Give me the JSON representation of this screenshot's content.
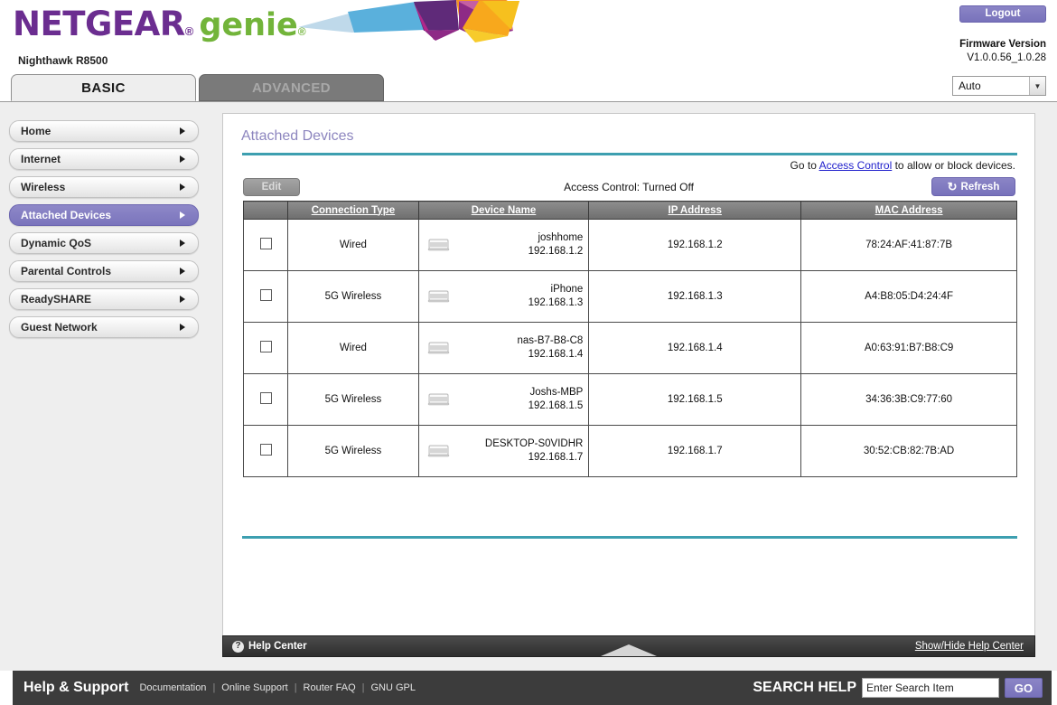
{
  "brand": {
    "name": "NETGEAR",
    "registered_mark": "®",
    "product": "genie",
    "product_mark": "®",
    "model": "Nighthawk R8500",
    "colors": {
      "netgear_purple": "#6b2d90",
      "genie_green": "#72b43a",
      "accent_purple": "#7872bb",
      "teal_rule": "#3d9fb0"
    }
  },
  "header": {
    "logout_label": "Logout",
    "firmware_label": "Firmware Version",
    "firmware_value": "V1.0.0.56_1.0.28",
    "language_selected": "Auto",
    "language_icon": "chevron-down-icon"
  },
  "tabs": [
    {
      "label": "BASIC",
      "active": true
    },
    {
      "label": "ADVANCED",
      "active": false
    }
  ],
  "sidebar": {
    "items": [
      {
        "label": "Home",
        "selected": false
      },
      {
        "label": "Internet",
        "selected": false
      },
      {
        "label": "Wireless",
        "selected": false
      },
      {
        "label": "Attached Devices",
        "selected": true
      },
      {
        "label": "Dynamic QoS",
        "selected": false
      },
      {
        "label": "Parental Controls",
        "selected": false
      },
      {
        "label": "ReadySHARE",
        "selected": false
      },
      {
        "label": "Guest Network",
        "selected": false
      }
    ]
  },
  "main": {
    "title": "Attached Devices",
    "access_note_prefix": "Go to ",
    "access_note_link": "Access Control",
    "access_note_suffix": " to allow or block devices.",
    "edit_label": "Edit",
    "access_control_status": "Access Control: Turned Off",
    "refresh_label": "Refresh",
    "refresh_icon": "refresh-icon",
    "table": {
      "columns": [
        "",
        "Connection Type",
        "Device Name",
        "IP Address",
        "MAC Address"
      ],
      "rows": [
        {
          "checked": false,
          "connection_type": "Wired",
          "device_icon": "computer-icon",
          "device_name": "joshhome",
          "device_ip": "192.168.1.2",
          "ip_address": "192.168.1.2",
          "mac_address": "78:24:AF:41:87:7B"
        },
        {
          "checked": false,
          "connection_type": "5G Wireless",
          "device_icon": "computer-icon",
          "device_name": "iPhone",
          "device_ip": "192.168.1.3",
          "ip_address": "192.168.1.3",
          "mac_address": "A4:B8:05:D4:24:4F"
        },
        {
          "checked": false,
          "connection_type": "Wired",
          "device_icon": "computer-icon",
          "device_name": "nas-B7-B8-C8",
          "device_ip": "192.168.1.4",
          "ip_address": "192.168.1.4",
          "mac_address": "A0:63:91:B7:B8:C9"
        },
        {
          "checked": false,
          "connection_type": "5G Wireless",
          "device_icon": "computer-icon",
          "device_name": "Joshs-MBP",
          "device_ip": "192.168.1.5",
          "ip_address": "192.168.1.5",
          "mac_address": "34:36:3B:C9:77:60"
        },
        {
          "checked": false,
          "connection_type": "5G Wireless",
          "device_icon": "computer-icon",
          "device_name": "DESKTOP-S0VIDHR",
          "device_ip": "192.168.1.7",
          "ip_address": "192.168.1.7",
          "mac_address": "30:52:CB:82:7B:AD"
        }
      ]
    }
  },
  "help_bar": {
    "icon": "question-mark-icon",
    "label": "Help Center",
    "toggle_icon": "triangle-up-icon",
    "show_hide_label": "Show/Hide Help Center"
  },
  "footer": {
    "title": "Help & Support",
    "links": [
      "Documentation",
      "Online Support",
      "Router FAQ",
      "GNU GPL"
    ],
    "separator": "|",
    "search_label": "SEARCH HELP",
    "search_placeholder": "Enter Search Item",
    "search_value": "",
    "go_label": "GO"
  }
}
